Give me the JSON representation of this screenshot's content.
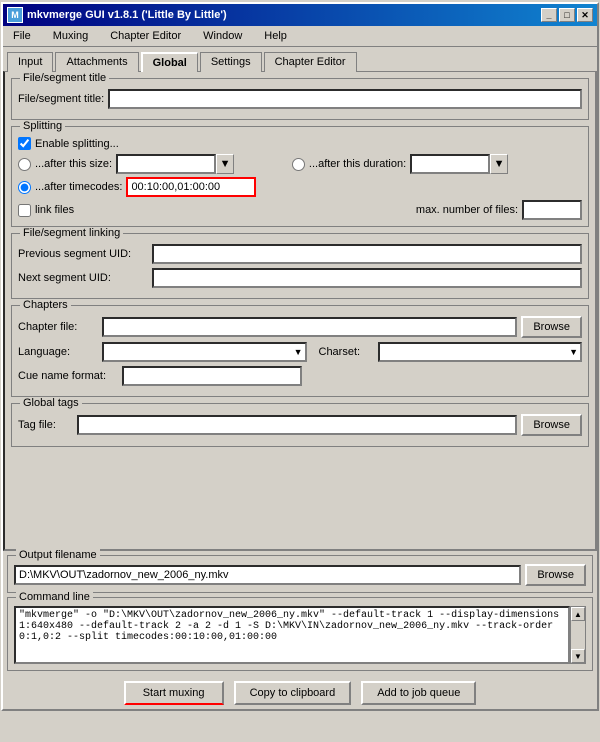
{
  "window": {
    "title": "mkvmerge GUI v1.8.1 ('Little By Little')",
    "icon": "M"
  },
  "title_buttons": {
    "minimize": "_",
    "maximize": "□",
    "close": "✕"
  },
  "menu": {
    "items": [
      "File",
      "Muxing",
      "Chapter Editor",
      "Window",
      "Help"
    ]
  },
  "tabs": {
    "items": [
      "Input",
      "Attachments",
      "Global",
      "Settings",
      "Chapter Editor"
    ],
    "active": 2
  },
  "file_segment": {
    "group_label": "File/segment title",
    "title_label": "File/segment title:",
    "title_value": ""
  },
  "splitting": {
    "group_label": "Splitting",
    "enable_label": "Enable splitting...",
    "enable_checked": true,
    "after_size_label": "...after this size:",
    "after_size_value": "",
    "after_duration_label": "...after this duration:",
    "after_duration_value": "",
    "after_timecodes_label": "...after timecodes:",
    "after_timecodes_value": "00:10:00,01:00:00",
    "after_timecodes_selected": true,
    "link_files_label": "link files",
    "max_files_label": "max. number of files:",
    "max_files_value": ""
  },
  "file_segment_linking": {
    "group_label": "File/segment linking",
    "prev_uid_label": "Previous segment UID:",
    "prev_uid_value": "",
    "next_uid_label": "Next segment UID:",
    "next_uid_value": ""
  },
  "chapters": {
    "group_label": "Chapters",
    "file_label": "Chapter file:",
    "file_value": "",
    "browse_label": "Browse",
    "language_label": "Language:",
    "language_value": "",
    "charset_label": "Charset:",
    "charset_value": "",
    "cue_label": "Cue name format:",
    "cue_value": ""
  },
  "global_tags": {
    "group_label": "Global tags",
    "tag_label": "Tag file:",
    "tag_value": "",
    "browse_label": "Browse"
  },
  "output": {
    "group_label": "Output filename",
    "value": "D:\\MKV\\OUT\\zadornov_new_2006_ny.mkv",
    "browse_label": "Browse"
  },
  "cmdline": {
    "group_label": "Command line",
    "value": "\"mkvmerge\" -o \"D:\\MKV\\OUT\\zadornov_new_2006_ny.mkv\" --default-track 1 --display-dimensions 1:640x480 --default-track 2 -a 2 -d 1 -S D:\\MKV\\IN\\zadornov_new_2006_ny.mkv --track-order 0:1,0:2 --split timecodes:00:10:00,01:00:00"
  },
  "bottom_buttons": {
    "start_label": "Start muxing",
    "clipboard_label": "Copy to clipboard",
    "job_label": "Add to job queue"
  }
}
